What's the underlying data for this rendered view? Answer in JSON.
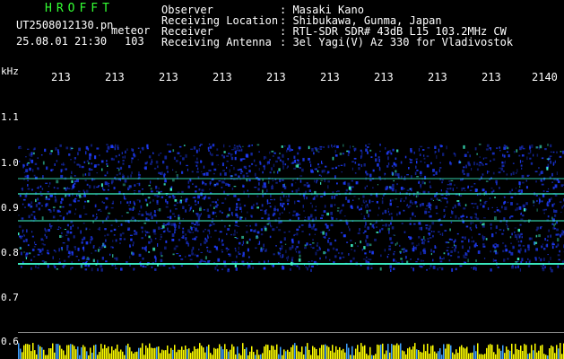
{
  "header": {
    "app_title": "HROFFT",
    "file_name": "UT2508012130.pn",
    "meteor_label": "meteor",
    "datetime": "25.08.01 21:30",
    "meteor_count": "103"
  },
  "info": {
    "observer_label": "Observer",
    "observer_value": ": Masaki Kano",
    "location_label": "Receiving Location",
    "location_value": ": Shibukawa, Gunma, Japan",
    "receiver_label": "Receiver",
    "receiver_value": ": RTL-SDR SDR# 43dB L15 103.2MHz CW",
    "antenna_label": "Receiving Antenna",
    "antenna_value": ": 3el Yagi(V) Az 330 for Vladivostok"
  },
  "axes": {
    "y_unit": "kHz",
    "y_ticks": [
      "1.1",
      "1.0",
      "0.9",
      "0.8",
      "0.7",
      "0.6"
    ],
    "x_ticks": [
      "213",
      "213",
      "213",
      "213",
      "213",
      "213",
      "213",
      "213",
      "213",
      "2140"
    ]
  },
  "colors": {
    "background": "#000000",
    "title_green": "#33ff33",
    "spectrum_blue": "#1f3dff",
    "signal_cyan": "#40ffd0",
    "level_yellow": "#ffff00"
  }
}
